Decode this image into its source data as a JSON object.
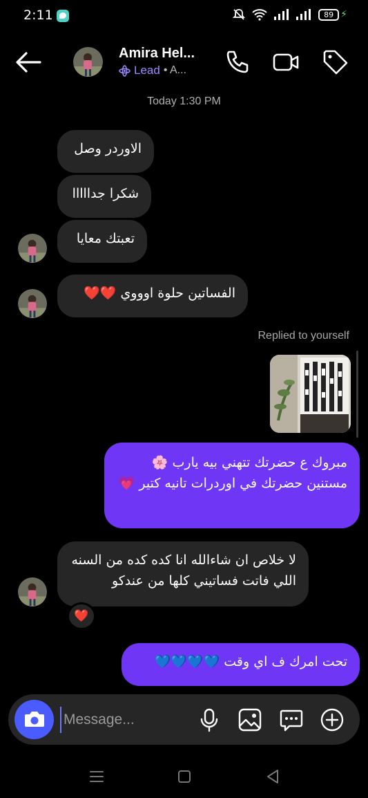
{
  "status": {
    "time": "2:11",
    "battery": "89"
  },
  "header": {
    "name": "Amira Hel...",
    "lead": "Lead",
    "sub": "• A..."
  },
  "chat": {
    "timestamp": "Today 1:30 PM",
    "incoming": [
      {
        "text": "الاوردر وصل"
      },
      {
        "text": "شكرا جدااااا"
      },
      {
        "text": "تعبتك معايا"
      },
      {
        "text": "الفساتين حلوة اوووي",
        "emoji": "❤️❤️"
      },
      {
        "text": "لا خلاص ان شاءالله انا كده كده من السنه اللي فاتت فساتيني كلها من عندكو"
      }
    ],
    "replied_label": "Replied to yourself",
    "outgoing": [
      {
        "text": "مبروك ع حضرتك تتهني بيه يارب 🌸 مستنين حضرتك في اوردرات تانيه كتير 💗"
      },
      {
        "text": "تحت امرك ف اي وقت",
        "emoji": "💙💙💙💙"
      }
    ],
    "reaction": "❤️"
  },
  "composer": {
    "placeholder": "Message..."
  },
  "icons": {
    "back": "arrow-left-icon",
    "call": "phone-icon",
    "video": "video-camera-icon",
    "tag": "tag-icon",
    "camera": "camera-icon",
    "mic": "microphone-icon",
    "gallery": "image-icon",
    "sticker": "chat-bubble-icon",
    "add": "plus-circle-icon"
  },
  "colors": {
    "outgoing": "#7036f5",
    "incoming": "#262626",
    "camera_button": "#4a5bff",
    "lead": "#9b8cff"
  }
}
